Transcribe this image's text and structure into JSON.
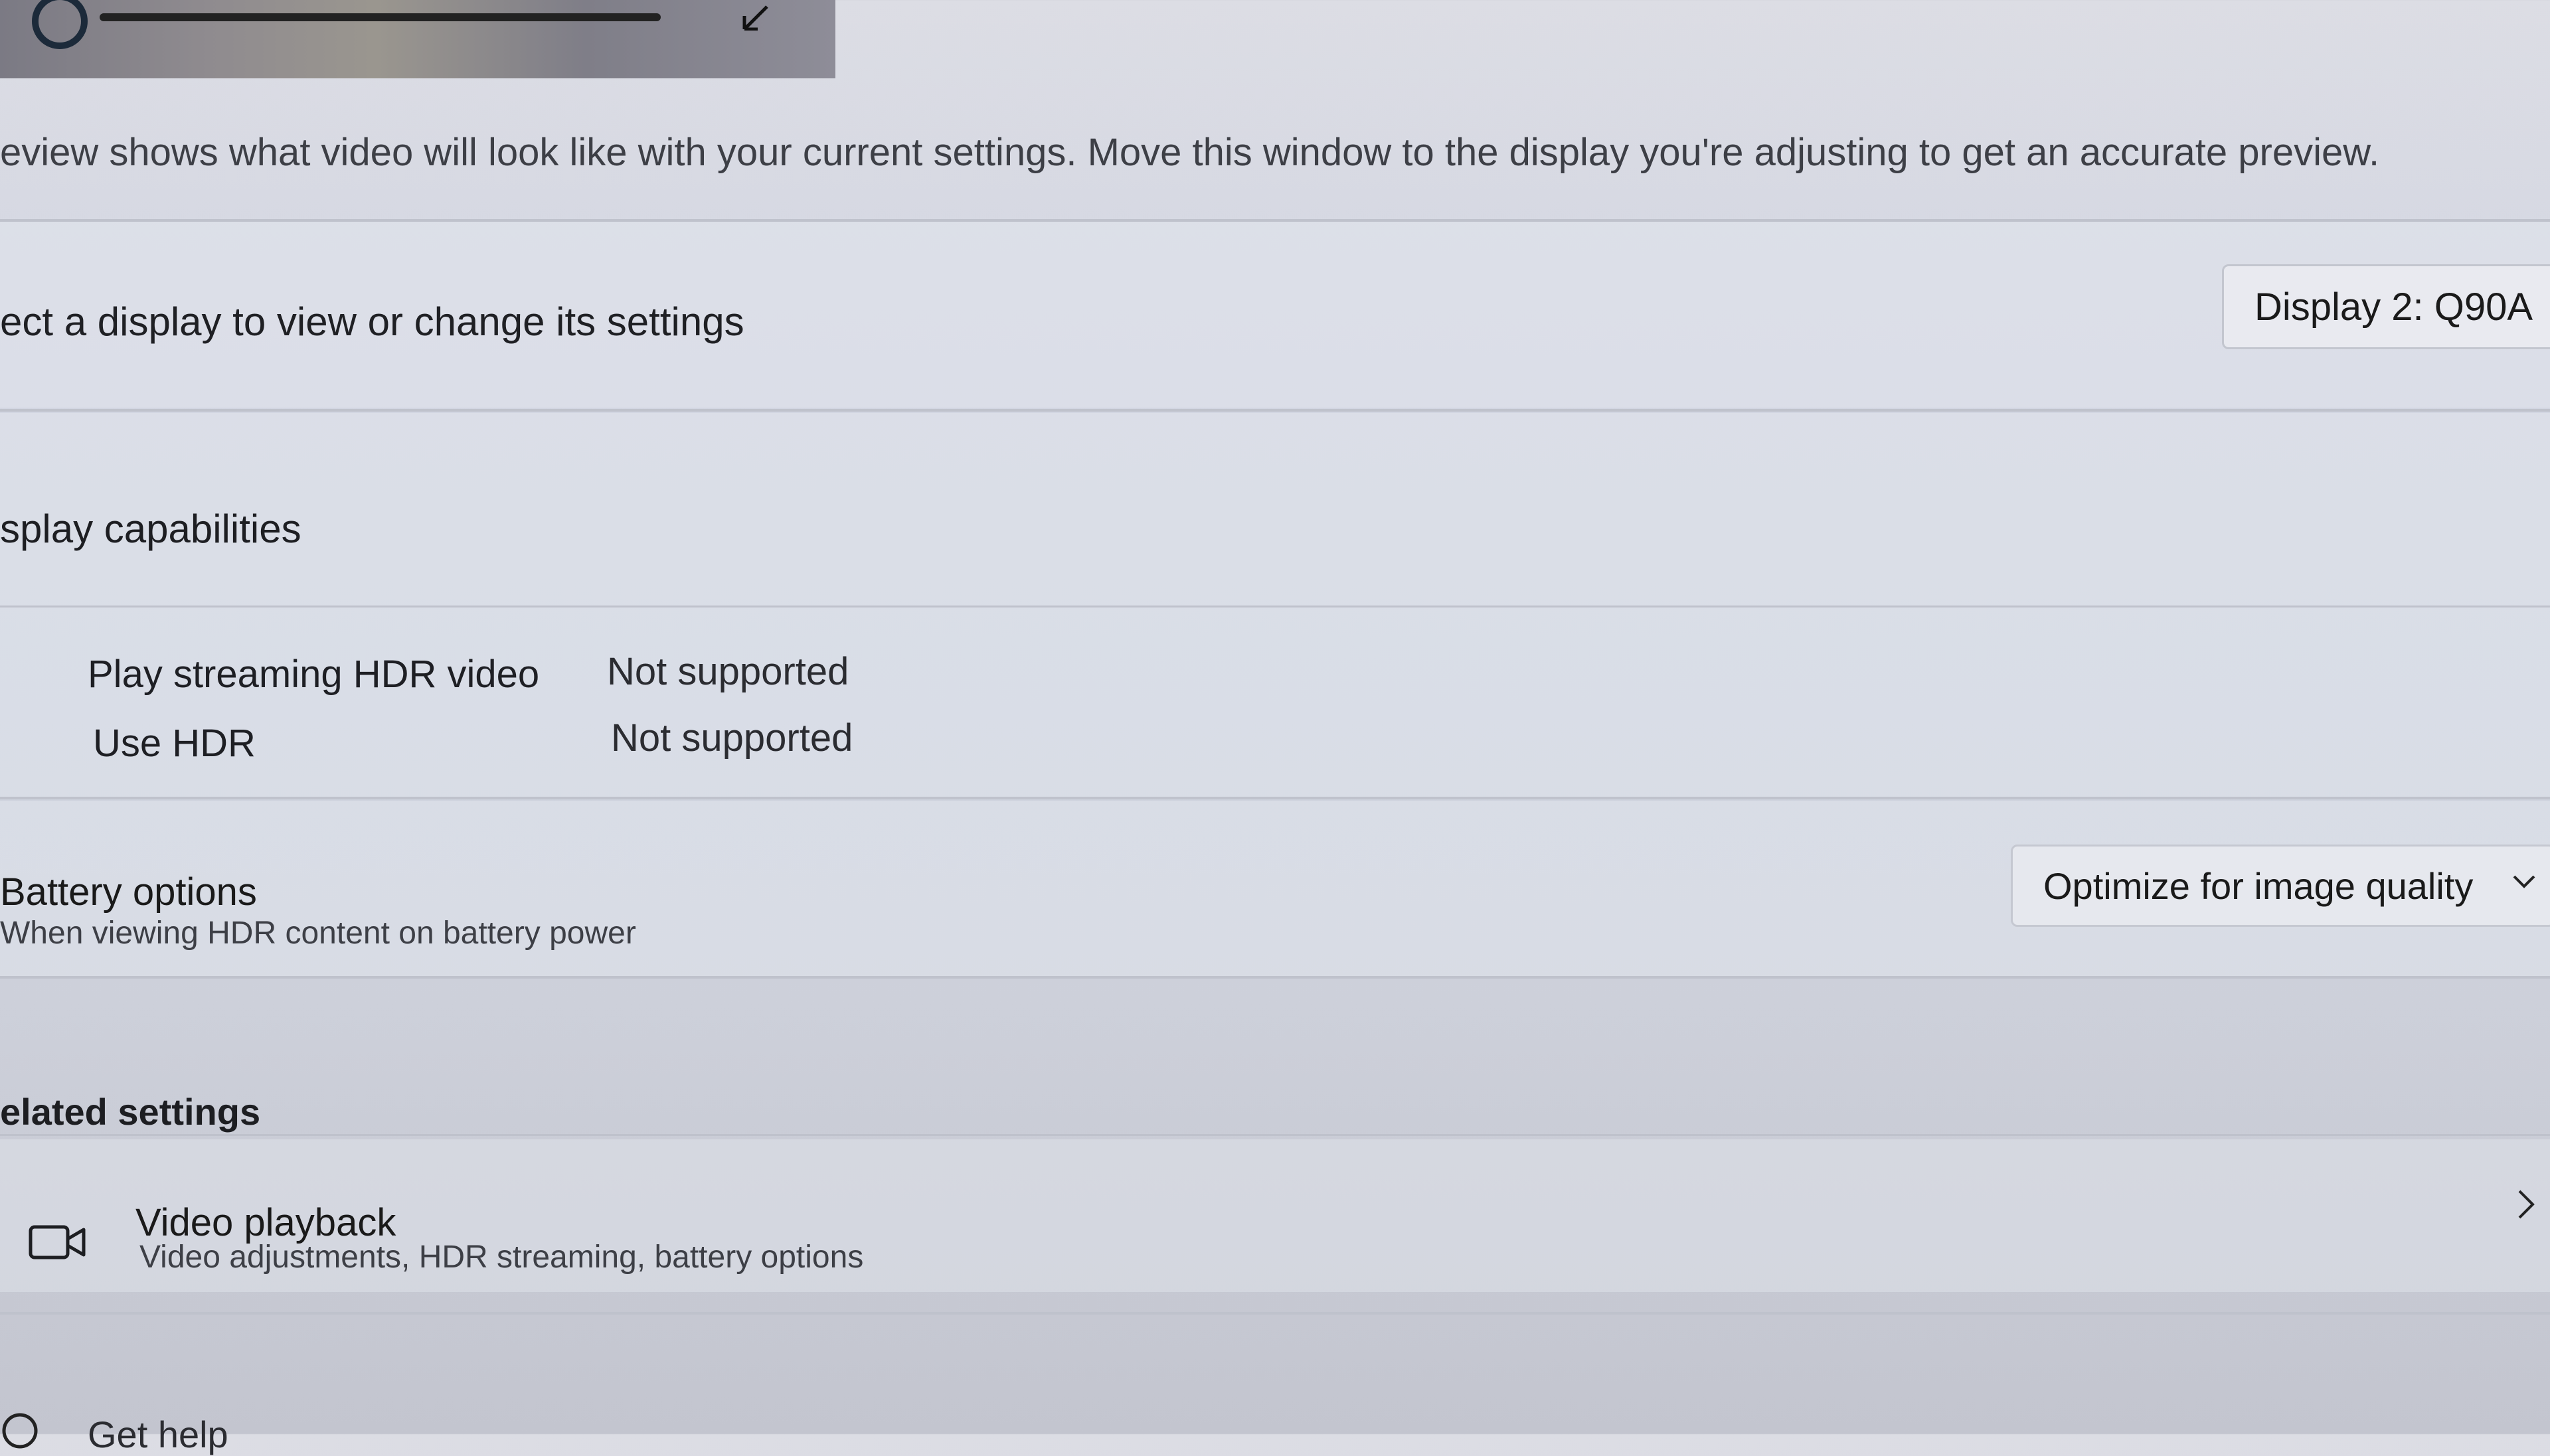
{
  "preview": {
    "expand_icon": "expand-diagonal-icon"
  },
  "description": "eview shows what video will look like with your current settings. Move this window to the display you're adjusting to get an accurate preview.",
  "display_select": {
    "label": "ect a display to view or change its settings",
    "selected": "Display 2: Q90A"
  },
  "capabilities": {
    "title": "splay capabilities",
    "rows": [
      {
        "label": "Play streaming HDR video",
        "value": "Not supported"
      },
      {
        "label": "Use HDR",
        "value": "Not supported"
      }
    ]
  },
  "battery": {
    "title": "Battery options",
    "subtitle": "When viewing HDR content on battery power",
    "selected": "Optimize for image quality",
    "chevron_icon": "chevron-down-icon"
  },
  "related": {
    "title": "elated settings",
    "video_playback": {
      "title": "Video playback",
      "subtitle": "Video adjustments, HDR streaming, battery options",
      "icon": "video-camera-icon",
      "chevron_icon": "chevron-right-icon"
    }
  },
  "help": {
    "label": "Get help",
    "icon": "help-icon"
  }
}
